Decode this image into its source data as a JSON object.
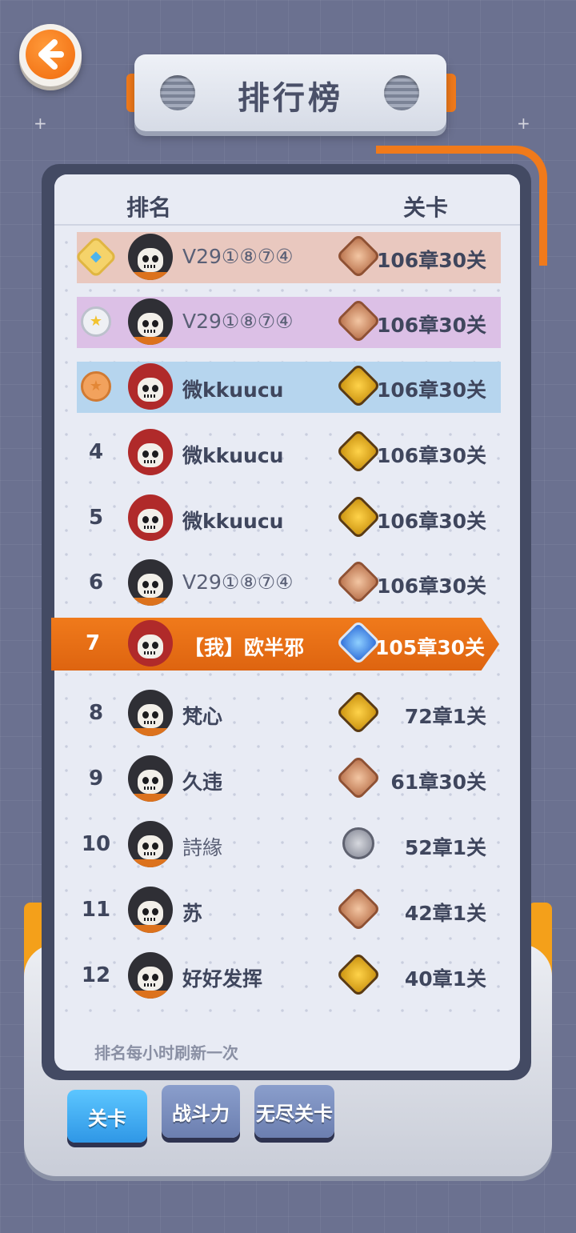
{
  "title": "排行榜",
  "header": {
    "rank_label": "排名",
    "level_label": "关卡"
  },
  "rows": [
    {
      "rank": "1",
      "medal": "gold",
      "avatar": "dark",
      "name": "V29①⑧⑦④",
      "badge": "copper",
      "level": "106章30关"
    },
    {
      "rank": "2",
      "medal": "silver",
      "avatar": "dark",
      "name": "V29①⑧⑦④",
      "badge": "copper",
      "level": "106章30关"
    },
    {
      "rank": "3",
      "medal": "bronze",
      "avatar": "red",
      "name": "微kkuucu",
      "badge": "gold",
      "level": "106章30关"
    },
    {
      "rank": "4",
      "avatar": "red",
      "name": "微kkuucu",
      "badge": "gold",
      "level": "106章30关"
    },
    {
      "rank": "5",
      "avatar": "red",
      "name": "微kkuucu",
      "badge": "gold",
      "level": "106章30关"
    },
    {
      "rank": "6",
      "avatar": "dark",
      "name": "V29①⑧⑦④",
      "badge": "copper",
      "level": "106章30关"
    },
    {
      "rank": "8",
      "avatar": "dark",
      "name": "梵心",
      "badge": "gold",
      "level": "72章1关"
    },
    {
      "rank": "9",
      "avatar": "dark",
      "name": "久违",
      "badge": "copper",
      "level": "61章30关"
    },
    {
      "rank": "10",
      "avatar": "dark",
      "name": "詩緣",
      "badge": "silver",
      "level": "52章1关"
    },
    {
      "rank": "11",
      "avatar": "dark",
      "name": "苏",
      "badge": "copper",
      "level": "42章1关"
    },
    {
      "rank": "12",
      "avatar": "dark",
      "name": "好好发挥",
      "badge": "gold",
      "level": "40章1关"
    }
  ],
  "my_row": {
    "rank": "7",
    "name": "【我】欧半邪",
    "badge": "diamond",
    "level": "105章30关"
  },
  "refresh_note": "排名每小时刷新一次",
  "tabs": [
    {
      "label": "关卡",
      "active": true
    },
    {
      "label": "战斗力",
      "active": false
    },
    {
      "label": "无尽关卡",
      "active": false
    }
  ],
  "colors": {
    "accent": "#f07a1b",
    "tab_active": "#3aa8f2",
    "tab_inactive": "#7b8ebf"
  }
}
